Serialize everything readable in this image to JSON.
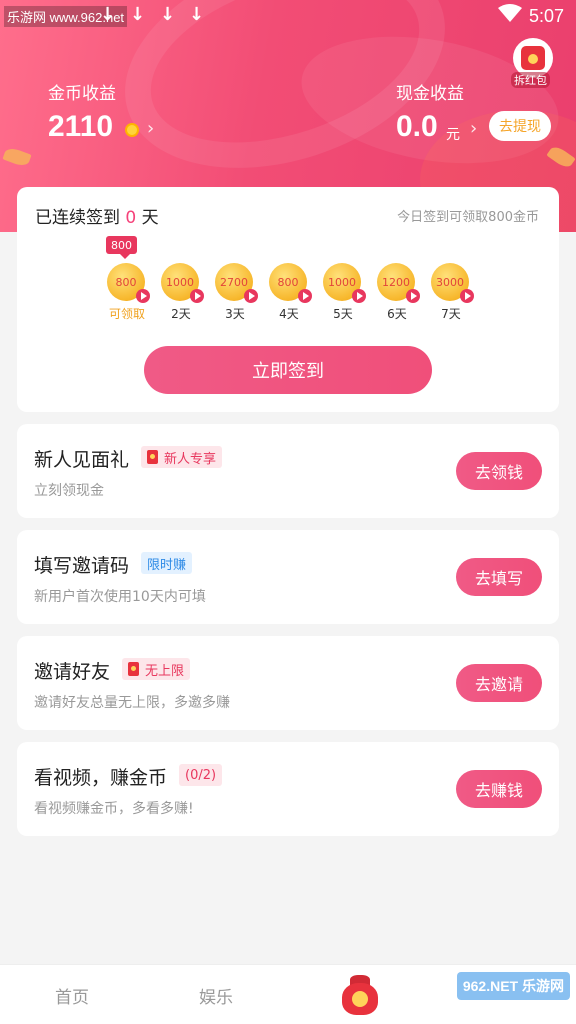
{
  "status_bar": {
    "watermark": "乐游网 www.962.net",
    "time": "5:07",
    "download_icon": "↓"
  },
  "header": {
    "redpack_label": "拆红包",
    "coin": {
      "label": "金币收益",
      "value": "2110",
      "chevron": "›"
    },
    "cash": {
      "label": "现金收益",
      "value": "0.0",
      "unit": "元",
      "chevron": "›",
      "withdraw_label": "去提现"
    }
  },
  "checkin": {
    "title_prefix": "已连续签到",
    "days": "0",
    "title_suffix": "天",
    "hint": "今日签到可领取800金币",
    "first_badge": "800",
    "days_list": [
      {
        "amount": "800",
        "label": "可领取"
      },
      {
        "amount": "1000",
        "label": "2天"
      },
      {
        "amount": "2700",
        "label": "3天"
      },
      {
        "amount": "800",
        "label": "4天"
      },
      {
        "amount": "1000",
        "label": "5天"
      },
      {
        "amount": "1200",
        "label": "6天"
      },
      {
        "amount": "3000",
        "label": "7天"
      }
    ],
    "button_label": "立即签到"
  },
  "tasks": [
    {
      "title": "新人见面礼",
      "tag": "新人专享",
      "desc": "立刻领现金",
      "button": "去领钱"
    },
    {
      "title": "填写邀请码",
      "tag": "限时赚",
      "desc": "新用户首次使用10天内可填",
      "button": "去填写"
    },
    {
      "title": "邀请好友",
      "tag": "无上限",
      "desc": "邀请好友总量无上限，多邀多赚",
      "button": "去邀请"
    },
    {
      "title": "看视频，赚金币",
      "tag": "(0/2)",
      "desc": "看视频赚金币，多看多赚!",
      "button": "去赚钱"
    }
  ],
  "bottom_nav": {
    "home": "首页",
    "entertainment": "娱乐",
    "footer_watermark": "962.NET 乐游网"
  },
  "colors": {
    "accent": "#f04f7a",
    "gold": "#f0a21f",
    "tag_blue": "#2f8be6"
  }
}
